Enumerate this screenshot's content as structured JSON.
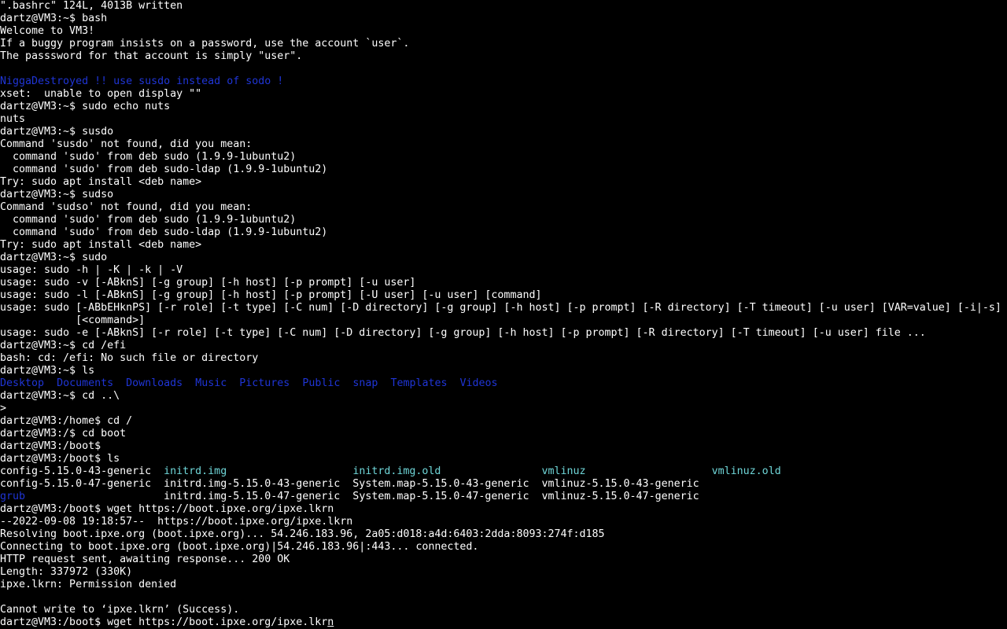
{
  "colors": {
    "background": "#000000",
    "text": "#ffffff",
    "directory": "#1f35d6",
    "link_cyan": "#6fd6d8"
  },
  "terminal": {
    "lines": [
      [
        {
          "t": "\".bashrc\" 124L, 4013B written"
        }
      ],
      [
        {
          "t": "dartz@VM3:~$ bash"
        }
      ],
      [
        {
          "t": "Welcome to VM3!"
        }
      ],
      [
        {
          "t": "If a buggy program insists on a password, use the account `user`."
        }
      ],
      [
        {
          "t": "The passsword for that account is simply \"user\"."
        }
      ],
      [
        {
          "t": ""
        }
      ],
      [
        {
          "t": "NiggaDestroyed !! use susdo instead of sodo !",
          "c": "err"
        }
      ],
      [
        {
          "t": "xset:  unable to open display \"\""
        }
      ],
      [
        {
          "t": "dartz@VM3:~$ sudo echo nuts"
        }
      ],
      [
        {
          "t": "nuts"
        }
      ],
      [
        {
          "t": "dartz@VM3:~$ susdo"
        }
      ],
      [
        {
          "t": "Command 'susdo' not found, did you mean:"
        }
      ],
      [
        {
          "t": "  command 'sudo' from deb sudo (1.9.9-1ubuntu2)"
        }
      ],
      [
        {
          "t": "  command 'sudo' from deb sudo-ldap (1.9.9-1ubuntu2)"
        }
      ],
      [
        {
          "t": "Try: sudo apt install <deb name>"
        }
      ],
      [
        {
          "t": "dartz@VM3:~$ sudso"
        }
      ],
      [
        {
          "t": "Command 'sudso' not found, did you mean:"
        }
      ],
      [
        {
          "t": "  command 'sudo' from deb sudo (1.9.9-1ubuntu2)"
        }
      ],
      [
        {
          "t": "  command 'sudo' from deb sudo-ldap (1.9.9-1ubuntu2)"
        }
      ],
      [
        {
          "t": "Try: sudo apt install <deb name>"
        }
      ],
      [
        {
          "t": "dartz@VM3:~$ sudo"
        }
      ],
      [
        {
          "t": "usage: sudo -h | -K | -k | -V"
        }
      ],
      [
        {
          "t": "usage: sudo -v [-ABknS] [-g group] [-h host] [-p prompt] [-u user]"
        }
      ],
      [
        {
          "t": "usage: sudo -l [-ABknS] [-g group] [-h host] [-p prompt] [-U user] [-u user] [command]"
        }
      ],
      [
        {
          "t": "usage: sudo [-ABbEHknPS] [-r role] [-t type] [-C num] [-D directory] [-g group] [-h host] [-p prompt] [-R directory] [-T timeout] [-u user] [VAR=value] [-i|-s]"
        }
      ],
      [
        {
          "t": "            [<command>]"
        }
      ],
      [
        {
          "t": "usage: sudo -e [-ABknS] [-r role] [-t type] [-C num] [-D directory] [-g group] [-h host] [-p prompt] [-R directory] [-T timeout] [-u user] file ..."
        }
      ],
      [
        {
          "t": "dartz@VM3:~$ cd /efi"
        }
      ],
      [
        {
          "t": "bash: cd: /efi: No such file or directory"
        }
      ],
      [
        {
          "t": "dartz@VM3:~$ ls"
        }
      ],
      [
        {
          "t": "Desktop",
          "c": "dir"
        },
        {
          "t": "  "
        },
        {
          "t": "Documents",
          "c": "dir"
        },
        {
          "t": "  "
        },
        {
          "t": "Downloads",
          "c": "dir"
        },
        {
          "t": "  "
        },
        {
          "t": "Music",
          "c": "dir"
        },
        {
          "t": "  "
        },
        {
          "t": "Pictures",
          "c": "dir"
        },
        {
          "t": "  "
        },
        {
          "t": "Public",
          "c": "dir"
        },
        {
          "t": "  "
        },
        {
          "t": "snap",
          "c": "dir"
        },
        {
          "t": "  "
        },
        {
          "t": "Templates",
          "c": "dir"
        },
        {
          "t": "  "
        },
        {
          "t": "Videos",
          "c": "dir"
        }
      ],
      [
        {
          "t": "dartz@VM3:~$ cd ..\\"
        }
      ],
      [
        {
          "t": "> "
        }
      ],
      [
        {
          "t": "dartz@VM3:/home$ cd /"
        }
      ],
      [
        {
          "t": "dartz@VM3:/$ cd boot"
        }
      ],
      [
        {
          "t": "dartz@VM3:/boot$"
        }
      ],
      [
        {
          "t": "dartz@VM3:/boot$ ls"
        }
      ],
      [
        {
          "t": "config-5.15.0-43-generic  "
        },
        {
          "t": "initrd.img",
          "c": "cyan"
        },
        {
          "t": "                    "
        },
        {
          "t": "initrd.img.old",
          "c": "cyan"
        },
        {
          "t": "                "
        },
        {
          "t": "vmlinuz",
          "c": "cyan"
        },
        {
          "t": "                    "
        },
        {
          "t": "vmlinuz.old",
          "c": "cyan"
        }
      ],
      [
        {
          "t": "config-5.15.0-47-generic  initrd.img-5.15.0-43-generic  System.map-5.15.0-43-generic  vmlinuz-5.15.0-43-generic"
        }
      ],
      [
        {
          "t": "grub",
          "c": "dir"
        },
        {
          "t": "                      initrd.img-5.15.0-47-generic  System.map-5.15.0-47-generic  vmlinuz-5.15.0-47-generic"
        }
      ],
      [
        {
          "t": "dartz@VM3:/boot$ wget https://boot.ipxe.org/ipxe.lkrn"
        }
      ],
      [
        {
          "t": "--2022-09-08 19:18:57--  https://boot.ipxe.org/ipxe.lkrn"
        }
      ],
      [
        {
          "t": "Resolving boot.ipxe.org (boot.ipxe.org)... 54.246.183.96, 2a05:d018:a4d:6403:2dda:8093:274f:d185"
        }
      ],
      [
        {
          "t": "Connecting to boot.ipxe.org (boot.ipxe.org)|54.246.183.96|:443... connected."
        }
      ],
      [
        {
          "t": "HTTP request sent, awaiting response... 200 OK"
        }
      ],
      [
        {
          "t": "Length: 337972 (330K)"
        }
      ],
      [
        {
          "t": "ipxe.lkrn: Permission denied"
        }
      ],
      [
        {
          "t": ""
        }
      ],
      [
        {
          "t": "Cannot write to ‘ipxe.lkrn’ (Success)."
        }
      ],
      [
        {
          "t": "dartz@VM3:/boot$ wget https://boot.ipxe.org/ipxe.lkr"
        },
        {
          "t": "n",
          "c": "cursor"
        }
      ]
    ]
  }
}
